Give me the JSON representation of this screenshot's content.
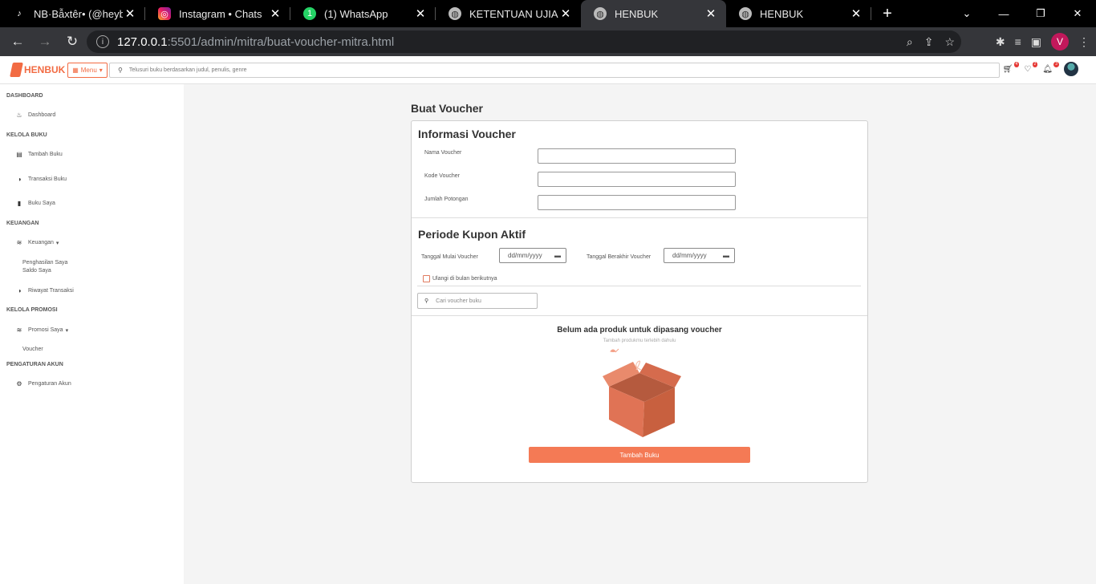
{
  "browser": {
    "tabs": [
      {
        "title": "NB·Bẫxtêr• (@heybaxter)",
        "icon": "tiktok-icon",
        "active": false
      },
      {
        "title": "Instagram • Chats",
        "icon": "instagram-icon",
        "active": false
      },
      {
        "title": "(1) WhatsApp",
        "icon": "whatsapp-icon",
        "active": false
      },
      {
        "title": "KETENTUAN UJIAN PR",
        "icon": "globe-icon",
        "active": false
      },
      {
        "title": "HENBUK",
        "icon": "globe-icon",
        "active": true
      },
      {
        "title": "HENBUK",
        "icon": "globe-icon",
        "active": false
      }
    ],
    "url_host": "127.0.0.1",
    "url_path": ":5501/admin/mitra/buat-voucher-mitra.html",
    "profile_initial": "V"
  },
  "header": {
    "logo": "HENBUK",
    "menu_label": "Menu",
    "search_placeholder": "Telusuri buku berdasarkan judul, penulis, genre",
    "cart_count": "4",
    "wishlist_count": "2",
    "notif_count": "3"
  },
  "sidebar": {
    "dashboard_section": "DASHBOARD",
    "dashboard": "Dashboard",
    "kelola_buku_section": "KELOLA BUKU",
    "tambah_buku": "Tambah Buku",
    "transaksi_buku": "Transaksi Buku",
    "buku_saya": "Buku Saya",
    "keuangan_section": "KEUANGAN",
    "keuangan": "Keuangan",
    "penghasilan": "Penghasilan Saya",
    "saldo": "Saldo Saya",
    "riwayat": "Riwayat Transaksi",
    "promosi_section": "KELOLA PROMOSI",
    "promosi": "Promosi Saya",
    "voucher": "Voucher",
    "pengaturan_section": "PENGATURAN AKUN",
    "pengaturan": "Pengaturan Akun"
  },
  "main": {
    "page_title": "Buat Voucher",
    "info_title": "Informasi Voucher",
    "nama_label": "Nama Voucher",
    "kode_label": "Kode Voucher",
    "potongan_label": "Jumlah Potongan",
    "periode_title": "Periode Kupon Aktif",
    "mulai_label": "Tanggal Mulai Voucher",
    "mulai_placeholder": "dd/mm/yyyy",
    "berakhir_label": "Tanggal Berakhir Voucher",
    "berakhir_placeholder": "dd/mm/yyyy",
    "ulangi_label": "Ulangi di bulan berikutnya",
    "search_placeholder": "Cari voucher buku",
    "empty_title": "Belum ada produk untuk dipasang voucher",
    "empty_subtitle": "Tambah produkmu terlebih dahulu",
    "add_button": "Tambah Buku"
  },
  "colors": {
    "accent": "#f26b43",
    "button": "#f47a55"
  }
}
